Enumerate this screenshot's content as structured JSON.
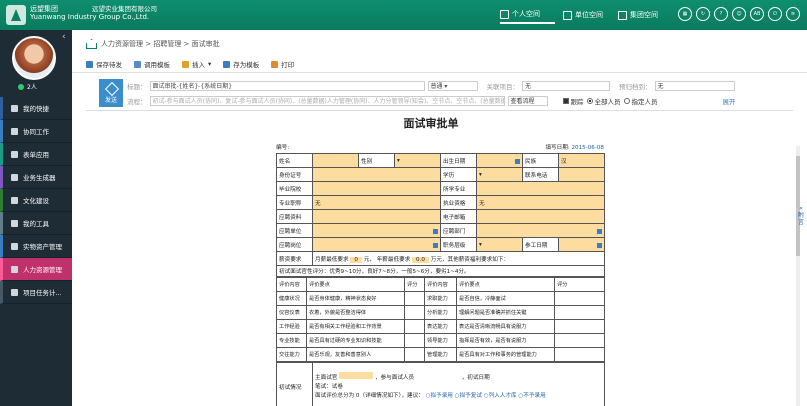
{
  "header": {
    "company_cn": "远望集团",
    "company_en": "Yuanwang Industry Group Co.,Ltd.",
    "company_full": "远望实业集团有限公司",
    "nav": [
      "个人空间",
      "单位空间",
      "集团空间"
    ],
    "icons": [
      "grid",
      "refresh",
      "help",
      "user",
      "AB",
      "power"
    ]
  },
  "sidebar": {
    "online": "2人",
    "items": [
      {
        "label": "我的快捷",
        "icon": "shortcut-icon"
      },
      {
        "label": "协同工作",
        "icon": "collab-icon"
      },
      {
        "label": "表单应用",
        "icon": "form-icon"
      },
      {
        "label": "业务生成器",
        "icon": "builder-icon"
      },
      {
        "label": "文化建设",
        "icon": "culture-icon"
      },
      {
        "label": "我的工具",
        "icon": "tools-icon"
      },
      {
        "label": "实物资产管理",
        "icon": "assets-icon"
      },
      {
        "label": "人力资源管理",
        "icon": "hr-icon"
      },
      {
        "label": "项目任务计...",
        "icon": "project-icon"
      }
    ]
  },
  "breadcrumb": "人力资源管理 > 招聘管理 > 面试审批",
  "toolbar": {
    "save": "保存待发",
    "call": "调用模板",
    "insert": "插入",
    "saveas": "存为模板",
    "print": "打印"
  },
  "send": "发送",
  "fields": {
    "title_label": "标题：",
    "title_value": "面试审批-{姓名}-{系统日期}",
    "priority": "普通",
    "related_label": "关联项目：",
    "related_value": "无",
    "archive_label": "预归档到：",
    "archive_value": "无",
    "flow_label": "流程：",
    "flow_placeholder": "初试-参与面试人员(协同)、复试-参与面试人员(协同)、(总量数据)人力管理(协同)、人力分管领导(知会)、空节点、空节点、(总量数据)",
    "view_flow": "查看流程",
    "track": "跟踪",
    "all": "全部人员",
    "specific": "指定人员",
    "expand": "展开"
  },
  "doc": {
    "title": "面试审批单",
    "number_label": "编号:",
    "date_label": "填写日期:",
    "date_value": "2015-06-08",
    "labels": {
      "name": "姓名",
      "gender": "性别",
      "birth": "出生日期",
      "ethnic": "民族",
      "ethnic_val": "汉",
      "id": "身份证号",
      "edu": "学历",
      "phone": "联系电话",
      "school": "毕业院校",
      "major": "所学专业",
      "title": "专业职称",
      "none": "无",
      "qual": "执业资格",
      "resume": "应聘资料",
      "email": "电子邮箱",
      "unit": "应聘单位",
      "dept": "应聘部门",
      "post": "应聘岗位",
      "level": "职务层级",
      "workdate": "参工日期",
      "salary": "薪资要求",
      "salary_min": "月薪最低要求",
      "salary_min_v": "0",
      "yuan": "元，",
      "salary_year": "年薪最低要求",
      "salary_year_v": "0.0",
      "wan": "万元，其他薪资福利要求如下：",
      "criteria": "初试面试官性评分：优秀9~10分，良好7~8分，一般5~6分，要劣1~4分。"
    },
    "eval_header": [
      "评价内容",
      "评价要点",
      "评分",
      "评价内容",
      "评价要点",
      "评分"
    ],
    "eval_rows": [
      [
        "健康状况",
        "是否身体健康，精神状态良好",
        "",
        "求职能力",
        "是否自信，冷静面试",
        ""
      ],
      [
        "仪容仪表",
        "衣着，外貌是否整洁得体",
        "",
        "分析能力",
        "理解问题是否准确并抓住关键",
        ""
      ],
      [
        "工作经验",
        "是否有相关工作经验和工作背景",
        "",
        "表达能力",
        "表达是否清晰流畅具有说服力",
        ""
      ],
      [
        "专业技能",
        "是否具有过硬的专业知识和技能",
        "",
        "领导能力",
        "指挥是否有效，是否有说服力",
        ""
      ],
      [
        "交往能力",
        "是否乐观，友善和善意别人",
        "",
        "管理能力",
        "是否具有对工作和事务的管理能力",
        ""
      ]
    ],
    "initial": {
      "label": "初试情况",
      "main_interviewer": "主面试官",
      "participants": "，参与面试人员",
      "date": "，初试日期",
      "written": "笔试：试卷",
      "score": "面试评价总分为 0（详细情况如下），建议：",
      "opt1": "拟予录用",
      "opt2": "拟予复试",
      "opt3": "列入人才库",
      "opt4": "不予录用"
    }
  },
  "right_panel": [
    "附",
    "言"
  ]
}
